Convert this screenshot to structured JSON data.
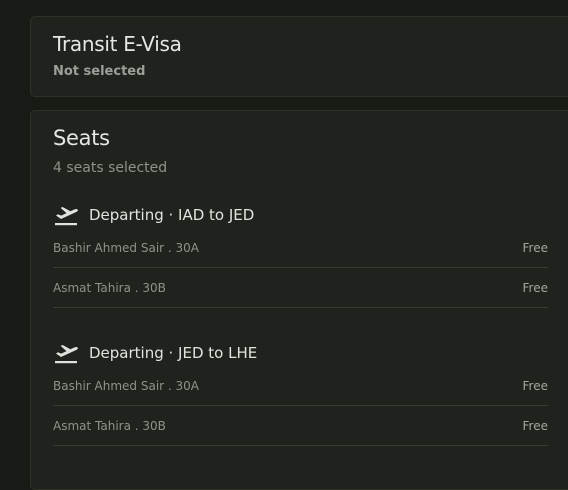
{
  "transit_visa": {
    "title": "Transit E-Visa",
    "status": "Not selected"
  },
  "seats": {
    "title": "Seats",
    "summary": "4 seats selected",
    "legs": [
      {
        "icon": "plane-departure-icon",
        "title": "Departing · IAD to JED",
        "passengers": [
          {
            "name_seat": "Bashir Ahmed Sair . 30A",
            "price": "Free"
          },
          {
            "name_seat": "Asmat Tahira . 30B",
            "price": "Free"
          }
        ]
      },
      {
        "icon": "plane-departure-icon",
        "title": "Departing · JED to LHE",
        "passengers": [
          {
            "name_seat": "Bashir Ahmed Sair . 30A",
            "price": "Free"
          },
          {
            "name_seat": "Asmat Tahira . 30B",
            "price": "Free"
          }
        ]
      }
    ]
  }
}
